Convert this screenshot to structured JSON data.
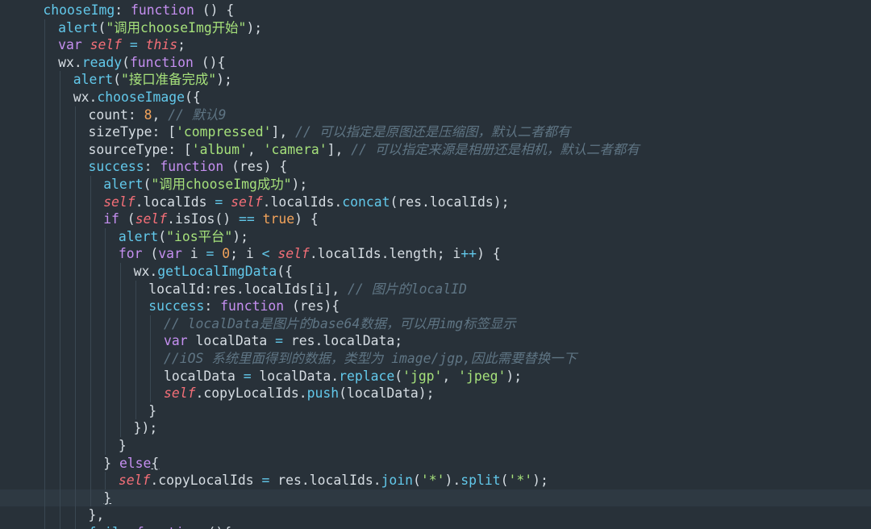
{
  "editor": {
    "colors": {
      "background": "#283139",
      "active_line": "#2e3942",
      "property": "#62c8ea",
      "keyword": "#c58ff0",
      "string": "#a5e07a",
      "number": "#f2a35a",
      "self": "#f46f78",
      "comment": "#5f7584",
      "text": "#d6dde3"
    },
    "active_line_index": 28,
    "lines": [
      {
        "indent": 2,
        "tokens": [
          [
            "chooseImg",
            "prop"
          ],
          [
            ": ",
            "pun"
          ],
          [
            "function",
            "kw"
          ],
          [
            " () {",
            "pun"
          ]
        ]
      },
      {
        "indent": 3,
        "tokens": [
          [
            "alert",
            "fn"
          ],
          [
            "(",
            "pun"
          ],
          [
            "\"调用chooseImg开始\"",
            "str"
          ],
          [
            ");",
            "pun"
          ]
        ]
      },
      {
        "indent": 3,
        "tokens": [
          [
            "var ",
            "kw"
          ],
          [
            "self",
            "self"
          ],
          [
            " = ",
            "op"
          ],
          [
            "this",
            "self"
          ],
          [
            ";",
            "pun"
          ]
        ]
      },
      {
        "indent": 3,
        "tokens": [
          [
            "wx",
            "txt"
          ],
          [
            ".",
            "pun"
          ],
          [
            "ready",
            "fn"
          ],
          [
            "(",
            "pun"
          ],
          [
            "function",
            "kw"
          ],
          [
            " (){",
            "pun"
          ]
        ]
      },
      {
        "indent": 4,
        "tokens": [
          [
            "alert",
            "fn"
          ],
          [
            "(",
            "pun"
          ],
          [
            "\"接口准备完成\"",
            "str"
          ],
          [
            ");",
            "pun"
          ]
        ]
      },
      {
        "indent": 4,
        "tokens": [
          [
            "wx",
            "txt"
          ],
          [
            ".",
            "pun"
          ],
          [
            "chooseImage",
            "fn"
          ],
          [
            "({",
            "pun"
          ]
        ]
      },
      {
        "indent": 5,
        "tokens": [
          [
            "count",
            "txt"
          ],
          [
            ": ",
            "pun"
          ],
          [
            "8",
            "num"
          ],
          [
            ", ",
            "pun"
          ],
          [
            "// 默认9",
            "cmt"
          ]
        ]
      },
      {
        "indent": 5,
        "tokens": [
          [
            "sizeType",
            "txt"
          ],
          [
            ": [",
            "pun"
          ],
          [
            "'compressed'",
            "str"
          ],
          [
            "], ",
            "pun"
          ],
          [
            "// 可以指定是原图还是压缩图，默认二者都有",
            "cmt"
          ]
        ]
      },
      {
        "indent": 5,
        "tokens": [
          [
            "sourceType",
            "txt"
          ],
          [
            ": [",
            "pun"
          ],
          [
            "'album'",
            "str"
          ],
          [
            ", ",
            "pun"
          ],
          [
            "'camera'",
            "str"
          ],
          [
            "], ",
            "pun"
          ],
          [
            "// 可以指定来源是相册还是相机，默认二者都有",
            "cmt"
          ]
        ]
      },
      {
        "indent": 5,
        "tokens": [
          [
            "success",
            "prop"
          ],
          [
            ": ",
            "pun"
          ],
          [
            "function",
            "kw"
          ],
          [
            " (",
            "pun"
          ],
          [
            "res",
            "txt"
          ],
          [
            ") {",
            "pun"
          ]
        ]
      },
      {
        "indent": 6,
        "tokens": [
          [
            "alert",
            "fn"
          ],
          [
            "(",
            "pun"
          ],
          [
            "\"调用chooseImg成功\"",
            "str"
          ],
          [
            ");",
            "pun"
          ]
        ]
      },
      {
        "indent": 6,
        "tokens": [
          [
            "self",
            "self"
          ],
          [
            ".localIds ",
            "txt"
          ],
          [
            "=",
            "op"
          ],
          [
            " ",
            "pun"
          ],
          [
            "self",
            "self"
          ],
          [
            ".localIds.",
            "txt"
          ],
          [
            "concat",
            "fn"
          ],
          [
            "(res.localIds);",
            "txt"
          ]
        ]
      },
      {
        "indent": 6,
        "tokens": [
          [
            "if",
            "kw"
          ],
          [
            " (",
            "pun"
          ],
          [
            "self",
            "self"
          ],
          [
            ".isIos() ",
            "txt"
          ],
          [
            "==",
            "op"
          ],
          [
            " ",
            "pun"
          ],
          [
            "true",
            "num"
          ],
          [
            ") {",
            "pun"
          ]
        ]
      },
      {
        "indent": 7,
        "tokens": [
          [
            "alert",
            "fn"
          ],
          [
            "(",
            "pun"
          ],
          [
            "\"ios平台\"",
            "str"
          ],
          [
            ");",
            "pun"
          ]
        ]
      },
      {
        "indent": 7,
        "tokens": [
          [
            "for",
            "kw"
          ],
          [
            " (",
            "pun"
          ],
          [
            "var",
            "kw"
          ],
          [
            " i ",
            "txt"
          ],
          [
            "=",
            "op"
          ],
          [
            " ",
            "pun"
          ],
          [
            "0",
            "num"
          ],
          [
            "; i ",
            "txt"
          ],
          [
            "<",
            "op"
          ],
          [
            " ",
            "pun"
          ],
          [
            "self",
            "self"
          ],
          [
            ".localIds.length; i",
            "txt"
          ],
          [
            "++",
            "op"
          ],
          [
            ") {",
            "pun"
          ]
        ]
      },
      {
        "indent": 8,
        "tokens": [
          [
            "wx",
            "txt"
          ],
          [
            ".",
            "pun"
          ],
          [
            "getLocalImgData",
            "fn"
          ],
          [
            "({",
            "pun"
          ]
        ]
      },
      {
        "indent": 9,
        "tokens": [
          [
            "localId",
            "txt"
          ],
          [
            ":res.localIds[i], ",
            "txt"
          ],
          [
            "// 图片的localID",
            "cmt"
          ]
        ]
      },
      {
        "indent": 9,
        "tokens": [
          [
            "success",
            "prop"
          ],
          [
            ": ",
            "pun"
          ],
          [
            "function",
            "kw"
          ],
          [
            " (",
            "pun"
          ],
          [
            "res",
            "txt"
          ],
          [
            "){",
            "pun"
          ]
        ]
      },
      {
        "indent": 10,
        "tokens": [
          [
            "// localData是图片的base64数据，可以用img标签显示",
            "cmt"
          ]
        ]
      },
      {
        "indent": 10,
        "tokens": [
          [
            "var",
            "kw"
          ],
          [
            " localData ",
            "txt"
          ],
          [
            "=",
            "op"
          ],
          [
            " res.localData;",
            "txt"
          ]
        ]
      },
      {
        "indent": 10,
        "tokens": [
          [
            "//iOS 系统里面得到的数据，类型为 image/jgp,因此需要替换一下",
            "cmt"
          ]
        ]
      },
      {
        "indent": 10,
        "tokens": [
          [
            "localData ",
            "txt"
          ],
          [
            "=",
            "op"
          ],
          [
            " localData.",
            "txt"
          ],
          [
            "replace",
            "fn"
          ],
          [
            "(",
            "pun"
          ],
          [
            "'jgp'",
            "str"
          ],
          [
            ", ",
            "pun"
          ],
          [
            "'jpeg'",
            "str"
          ],
          [
            ");",
            "pun"
          ]
        ]
      },
      {
        "indent": 10,
        "tokens": [
          [
            "self",
            "self"
          ],
          [
            ".copyLocalIds.",
            "txt"
          ],
          [
            "push",
            "fn"
          ],
          [
            "(localData);",
            "txt"
          ]
        ]
      },
      {
        "indent": 9,
        "tokens": [
          [
            "}",
            "pun"
          ]
        ]
      },
      {
        "indent": 8,
        "tokens": [
          [
            "});",
            "pun"
          ]
        ]
      },
      {
        "indent": 7,
        "tokens": [
          [
            "}",
            "pun"
          ]
        ]
      },
      {
        "indent": 6,
        "tokens": [
          [
            "} ",
            "pun"
          ],
          [
            "else",
            "kw"
          ],
          [
            "{",
            "cursor"
          ]
        ]
      },
      {
        "indent": 7,
        "tokens": [
          [
            "self",
            "self"
          ],
          [
            ".copyLocalIds ",
            "txt"
          ],
          [
            "=",
            "op"
          ],
          [
            " res.localIds.",
            "txt"
          ],
          [
            "join",
            "fn"
          ],
          [
            "(",
            "pun"
          ],
          [
            "'*'",
            "str"
          ],
          [
            ").",
            "pun"
          ],
          [
            "split",
            "fn"
          ],
          [
            "(",
            "pun"
          ],
          [
            "'*'",
            "str"
          ],
          [
            ");",
            "pun"
          ]
        ]
      },
      {
        "indent": 6,
        "tokens": [
          [
            "}",
            "cursor"
          ]
        ]
      },
      {
        "indent": 5,
        "tokens": [
          [
            "},",
            "pun"
          ]
        ]
      },
      {
        "indent": 5,
        "tokens": [
          [
            "fail",
            "prop"
          ],
          [
            ": ",
            "pun"
          ],
          [
            "function",
            "kw"
          ],
          [
            " (){",
            "pun"
          ]
        ]
      }
    ]
  }
}
